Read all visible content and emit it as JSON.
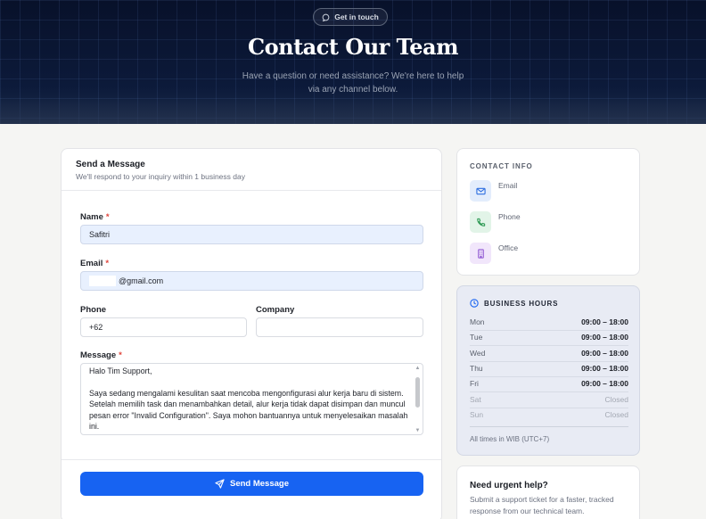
{
  "hero": {
    "badge": "Get in touch",
    "title": "Contact Our Team",
    "subtitle": "Have a question or need assistance? We're here to help via any channel below."
  },
  "form": {
    "title": "Send a Message",
    "subtitle": "We'll respond to your inquiry within 1 business day",
    "name_label": "Name",
    "name_value": "Safitri",
    "email_label": "Email",
    "email_value": "@gmail.com",
    "phone_label": "Phone",
    "phone_value": "+62",
    "company_label": "Company",
    "company_value": "",
    "message_label": "Message",
    "required_mark": "*",
    "message_value": "Halo Tim Support,\n\nSaya sedang mengalami kesulitan saat mencoba mengonfigurasi alur kerja baru di sistem. Setelah memilih task dan menambahkan detail, alur kerja tidak dapat disimpan dan muncul pesan error \"Invalid Configuration\". Saya mohon bantuannya untuk menyelesaikan masalah ini.",
    "send_label": "Send Message"
  },
  "contact_info": {
    "title": "CONTACT INFO",
    "items": [
      {
        "label": "Email",
        "icon": "mail-icon",
        "color": "#2f6fe0",
        "bg": "#e3edfc"
      },
      {
        "label": "Phone",
        "icon": "phone-icon",
        "color": "#2f9a55",
        "bg": "#e2f4e8"
      },
      {
        "label": "Office",
        "icon": "building-icon",
        "color": "#8a4fd0",
        "bg": "#f1e6fb"
      }
    ]
  },
  "hours": {
    "title": "BUSINESS HOURS",
    "rows": [
      {
        "day": "Mon",
        "time": "09:00 – 18:00"
      },
      {
        "day": "Tue",
        "time": "09:00 – 18:00"
      },
      {
        "day": "Wed",
        "time": "09:00 – 18:00"
      },
      {
        "day": "Thu",
        "time": "09:00 – 18:00"
      },
      {
        "day": "Fri",
        "time": "09:00 – 18:00"
      },
      {
        "day": "Sat",
        "time": "Closed"
      },
      {
        "day": "Sun",
        "time": "Closed"
      }
    ],
    "note": "All times in WIB (UTC+7)"
  },
  "urgent": {
    "title": "Need urgent help?",
    "text": "Submit a support ticket for a faster, tracked response from our technical team."
  }
}
